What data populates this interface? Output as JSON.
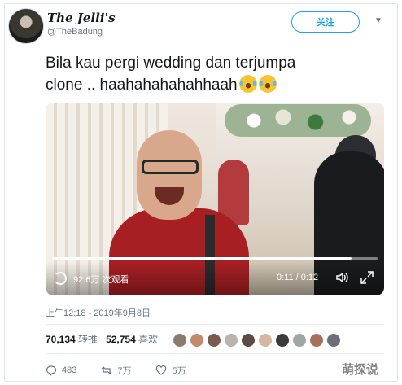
{
  "header": {
    "display_name": "The Jelli's",
    "handle": "@TheBadung",
    "follow_label": "关注"
  },
  "tweet": {
    "line1": "Bila kau pergi wedding dan terjumpa",
    "line2": "clone .. haahahahahahhaah",
    "emojis": [
      "tears-of-joy-icon",
      "tears-of-joy-icon"
    ]
  },
  "video": {
    "views": "92.6万 次观看",
    "time": "0:11 / 0:12",
    "progress": 0.92
  },
  "meta": {
    "timestamp": "上午12:18 - 2019年9月8日"
  },
  "stats": {
    "retweets_count": "70,134",
    "retweets_label": "转推",
    "likes_count": "52,754",
    "likes_label": "喜欢",
    "liker_colors": [
      "#8a7a6e",
      "#c08b6d",
      "#7a5c4e",
      "#b8b3ad",
      "#5d4a44",
      "#d4b7a3",
      "#3b3b3b",
      "#9ea8a0",
      "#a86f5e",
      "#6c6f77"
    ]
  },
  "actions": {
    "reply_count": "483",
    "retweet_count": "7万",
    "like_count": "5万"
  },
  "watermark": "萌探说",
  "colors": {
    "accent": "#1da1f2",
    "secondary_text": "#657786"
  }
}
